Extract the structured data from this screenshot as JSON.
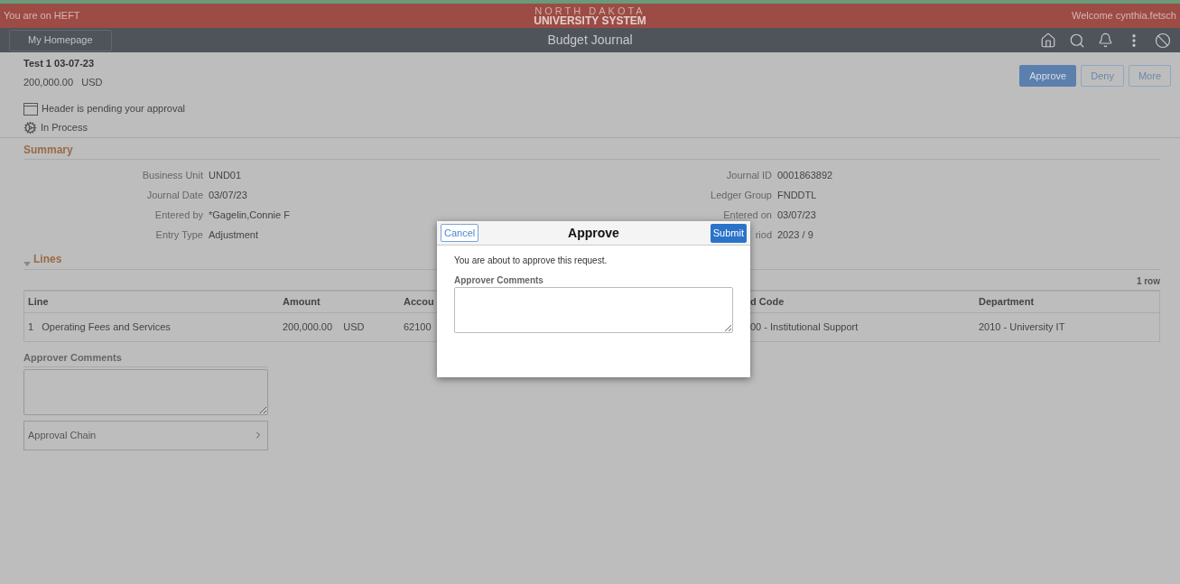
{
  "banner": {
    "environment": "You are on HEFT",
    "logo_top": "NORTH DAKOTA",
    "logo_bottom": "UNIVERSITY SYSTEM",
    "welcome": "Welcome cynthia.fetsch"
  },
  "nav": {
    "home_button": "My Homepage",
    "title": "Budget Journal"
  },
  "header": {
    "name": "Test 1 03-07-23",
    "amount": "200,000.00",
    "currency": "USD",
    "status_lines": [
      {
        "kind": "pending",
        "text": "Header is pending your approval"
      },
      {
        "kind": "process",
        "text": "In Process"
      }
    ]
  },
  "actions": [
    {
      "label": "Approve",
      "primary": true
    },
    {
      "label": "Deny",
      "primary": false
    },
    {
      "label": "More",
      "primary": false
    }
  ],
  "summary": {
    "title": "Summary",
    "left": [
      {
        "label": "Business Unit",
        "value": "UND01"
      },
      {
        "label": "Journal Date",
        "value": "03/07/23"
      },
      {
        "label": "Entered by",
        "value": "*Gagelin,Connie F"
      },
      {
        "label": "Entry Type",
        "value": "Adjustment"
      }
    ],
    "right": [
      {
        "label": "Journal ID",
        "value": "0001863892"
      },
      {
        "label": "Ledger Group",
        "value": "FNDDTL"
      },
      {
        "label": "Entered on",
        "value": "03/07/23"
      },
      {
        "label": "riod",
        "value": "2023 / 9"
      }
    ]
  },
  "lines": {
    "title": "Lines",
    "expanded": true,
    "row_count": "1 row",
    "columns": [
      "Line",
      "Amount",
      "Accou",
      "d Code",
      "Department"
    ],
    "rows": [
      {
        "line": "1",
        "description": "Operating Fees and Services",
        "amount": "200,000.00",
        "currency": "USD",
        "column_3": "62100",
        "column_4": "00 - Institutional Support",
        "department": "2010 - University IT"
      }
    ]
  },
  "comments": {
    "label": "Approver Comments"
  },
  "approval_chain": "Approval Chain",
  "dialog": {
    "title": "Approve",
    "cancel": "Cancel",
    "submit": "Submit",
    "message": "You are about to approve this request.",
    "comments_label": "Approver Comments"
  }
}
